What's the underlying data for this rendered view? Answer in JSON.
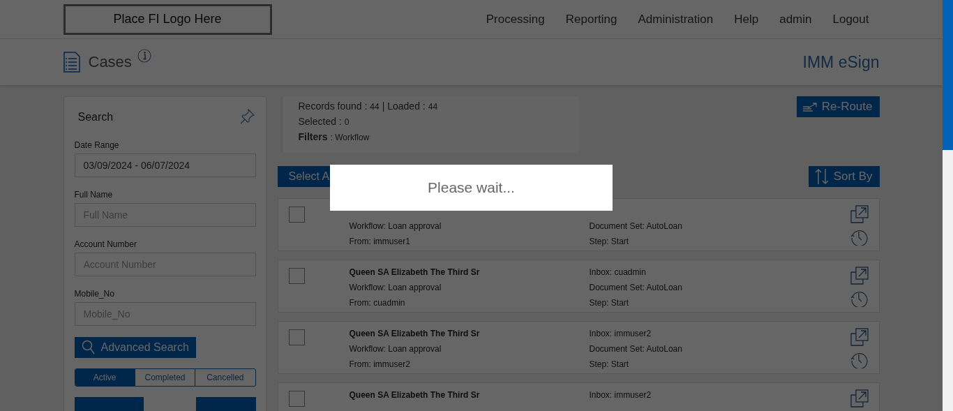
{
  "logo": {
    "text": "Place FI Logo Here"
  },
  "nav": [
    "Processing",
    "Reporting",
    "Administration",
    "Help",
    "admin",
    "Logout"
  ],
  "page": {
    "title": "Cases",
    "app_name": "IMM eSign"
  },
  "search_panel": {
    "title": "Search",
    "fields": [
      {
        "label": "Date Range",
        "value": "03/09/2024 - 06/07/2024"
      },
      {
        "label": "Full Name",
        "placeholder": "Full Name"
      },
      {
        "label": "Account Number",
        "placeholder": "Account Number"
      },
      {
        "label": "Mobile_No",
        "placeholder": "Mobile_No"
      }
    ],
    "advanced_button": "Advanced Search",
    "status_tabs": [
      {
        "label": "Active",
        "selected": true
      },
      {
        "label": "Completed",
        "selected": false
      },
      {
        "label": "Cancelled",
        "selected": false
      }
    ]
  },
  "summary": {
    "lines": [
      {
        "parts": [
          {
            "kind": "label",
            "text": "Records found :"
          },
          {
            "kind": "value",
            "text": "44"
          },
          {
            "kind": "label",
            "text": "| Loaded :"
          },
          {
            "kind": "value",
            "text": "44"
          }
        ]
      },
      {
        "parts": [
          {
            "kind": "label",
            "text": "Selected :"
          },
          {
            "kind": "value",
            "text": "0"
          }
        ]
      },
      {
        "parts": [
          {
            "kind": "strong",
            "text": "Filters"
          },
          {
            "kind": "value",
            "text": ": Workflow"
          }
        ]
      }
    ]
  },
  "reroute_button": "Re-Route",
  "select_all_button": "Select A",
  "sort_button": "Sort By",
  "rows": [
    {
      "checked": false,
      "details_left": [
        "Workflow: Loan approval",
        "From: immuser1"
      ],
      "details_right": [
        "Document Set: AutoLoan",
        "Step: Start"
      ]
    },
    {
      "checked": false,
      "name": "Queen SA Elizabeth The Third Sr",
      "details_left": [
        "Workflow: Loan approval",
        "From: cuadmin"
      ],
      "details_right": [
        "Inbox: cuadmin",
        "Document Set: AutoLoan",
        "Step: Start"
      ]
    },
    {
      "checked": false,
      "name": "Queen SA Elizabeth The Third Sr",
      "details_left": [
        "Workflow: Loan approval",
        "From: immuser2"
      ],
      "details_right": [
        "Inbox: immuser2",
        "Document Set: AutoLoan",
        "Step: Start"
      ]
    },
    {
      "checked": false,
      "name": "Queen SA Elizabeth The Third Sr",
      "details_left": [],
      "details_right": [
        "Inbox: immuser2"
      ]
    }
  ],
  "loading": {
    "message": "Please wait..."
  }
}
